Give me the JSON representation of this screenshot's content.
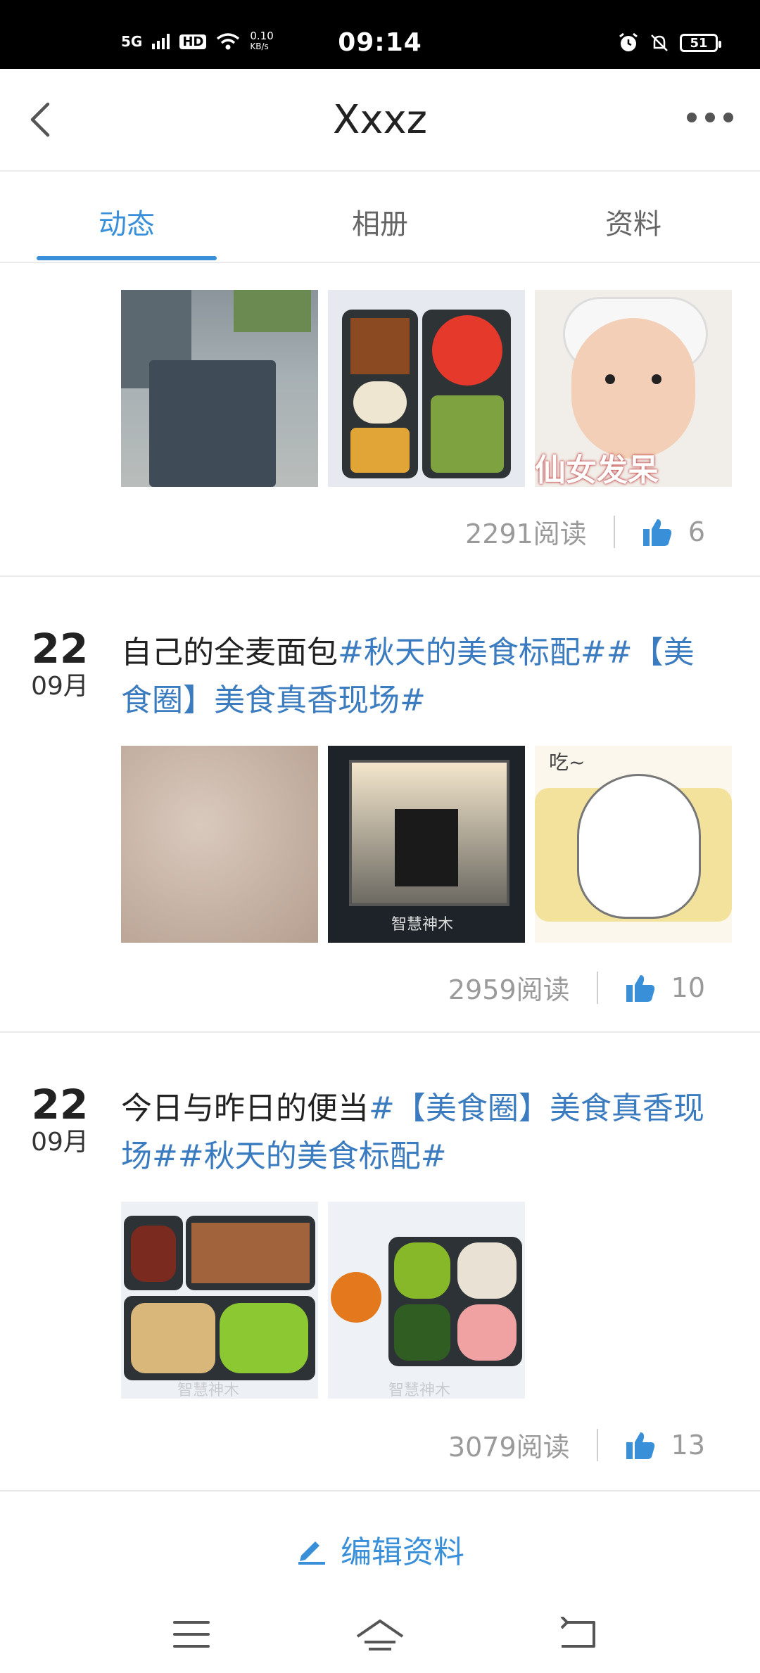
{
  "status_bar": {
    "network": "5G",
    "hd": "HD",
    "speed_value": "0.10",
    "speed_unit": "KB/s",
    "time": "09:14",
    "battery": "51"
  },
  "header": {
    "title": "Xxxz"
  },
  "tabs": [
    {
      "label": "动态",
      "active": true
    },
    {
      "label": "相册",
      "active": false
    },
    {
      "label": "资料",
      "active": false
    }
  ],
  "posts": [
    {
      "reads": "2291阅读",
      "likes": "6",
      "images": [
        "tote-bag-photo",
        "bento-box-photo",
        "baby-meme-photo"
      ],
      "image_caption_3": "仙女发呆"
    },
    {
      "day": "22",
      "month": "09月",
      "text_plain": "自己的全麦面包",
      "text_tag": "#秋天的美食标配##【美食圈】美食真香现场#",
      "reads": "2959阅读",
      "likes": "10",
      "images": [
        "bread-texture-photo",
        "oven-photo",
        "hamster-meme-photo"
      ],
      "image_caption_3": "吃~",
      "watermark": "智慧神木"
    },
    {
      "day": "22",
      "month": "09月",
      "text_plain": "今日与昨日的便当",
      "text_tag": "#【美食圈】美食真香现场##秋天的美食标配#",
      "reads": "3079阅读",
      "likes": "13",
      "images": [
        "bento-broccoli-photo",
        "bento-lotus-photo"
      ],
      "watermark": "智慧神木"
    }
  ],
  "bottom_bar": {
    "edit_label": "编辑资料"
  },
  "colors": {
    "accent": "#3a8fd9",
    "tag": "#3b7bbf",
    "meta": "#9a9a9a"
  }
}
